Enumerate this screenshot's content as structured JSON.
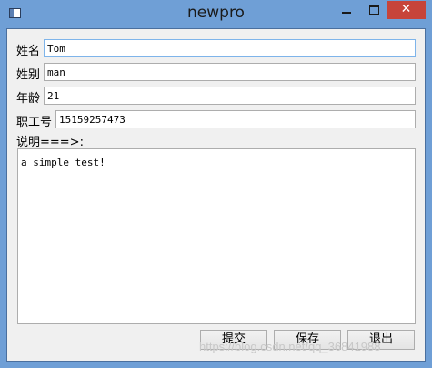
{
  "window": {
    "title": "newpro",
    "close_glyph": "✕",
    "accent": "#6f9fd6",
    "close_color": "#c7443a"
  },
  "form": {
    "name": {
      "label": "姓名",
      "value": "Tom"
    },
    "gender": {
      "label": "姓别",
      "value": "man"
    },
    "age": {
      "label": "年龄",
      "value": "21"
    },
    "employee_id": {
      "label": "职工号",
      "value": "15159257473"
    },
    "description": {
      "label": "说明===>:",
      "value": "a simple test!"
    }
  },
  "buttons": {
    "submit": "提交",
    "save": "保存",
    "exit": "退出"
  },
  "watermark": "https://blog.csdn.net/qq_36841988"
}
